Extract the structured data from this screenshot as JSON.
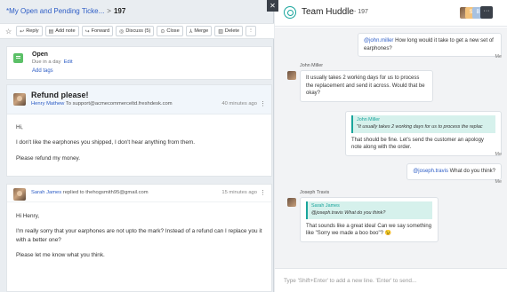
{
  "breadcrumb": {
    "star": "*",
    "title": "My Open and Pending Ticke...",
    "separator": ">",
    "ticket_number": "197"
  },
  "toolbar": {
    "star_icon": "star-icon",
    "buttons": [
      {
        "icon": "reply-icon",
        "glyph": "↩",
        "label": "Reply"
      },
      {
        "icon": "note-icon",
        "glyph": "▤",
        "label": "Add note"
      },
      {
        "icon": "forward-icon",
        "glyph": "↪",
        "label": "Forward"
      },
      {
        "icon": "discuss-icon",
        "glyph": "◎",
        "label": "Discuss (5)"
      },
      {
        "icon": "close-icon",
        "glyph": "⊙",
        "label": "Close"
      },
      {
        "icon": "merge-icon",
        "glyph": "⅄",
        "label": "Merge"
      },
      {
        "icon": "trash-icon",
        "glyph": "▥",
        "label": "Delete"
      }
    ],
    "more_glyph": "⋮"
  },
  "status": {
    "state": "Open",
    "due": "Due in a day",
    "edit": "Edit",
    "add_tags": "Add tags"
  },
  "ticket": {
    "subject": "Refund please!",
    "from_name": "Henry Mathew",
    "to_word": "To",
    "to_email": "support@acmecommerceltd.freshdesk.com",
    "time": "40 minutes ago",
    "body": [
      "Hi,",
      "I don't like the earphones you shipped, I don't hear anything from them.",
      "Please refund my money."
    ]
  },
  "reply": {
    "from_name": "Sarah James",
    "action": "replied to",
    "to_email": "thehogsmith95@gmail.com",
    "time": "15 minutes ago",
    "body": [
      "Hi Henry,",
      "I'm really sorry that your earphones are not upto the mark? Instead of a refund can I replace you it with a better one?",
      "Please let me know what you think."
    ]
  },
  "huddle": {
    "title": "Team Huddle",
    "subtitle": "- 197",
    "avatar_letters": [
      "S",
      "B"
    ],
    "more_glyph": "···",
    "close_glyph": "✕",
    "messages": {
      "m1": {
        "mention": "@john.miller",
        "text": " How long would it take to get a new set of earphones?",
        "who": "Me"
      },
      "m2": {
        "sender": "John Miller",
        "text": "It usually takes 2 working days for us to process the replacement and send it across. Would that be okay?"
      },
      "m3": {
        "quote_name": "John Miller",
        "quote_text": "\"It usually takes 2 working days for us to process the replac",
        "text": "That should be fine. Let's send the customer an apology note along with the order.",
        "who": "Me"
      },
      "m4": {
        "mention": "@joseph.travis",
        "text": " What do you think?",
        "who": "Me"
      },
      "m5": {
        "sender": "Joseph Travis",
        "quote_name": "Sarah James",
        "quote_text": "@joseph.travis What do you think?",
        "text": "That sounds like a great idea! Can we say something like \"Sorry we made a boo boo\"? 😉"
      }
    },
    "composer_placeholder": "Type 'Shift+Enter' to add a new line. 'Enter' to send..."
  }
}
